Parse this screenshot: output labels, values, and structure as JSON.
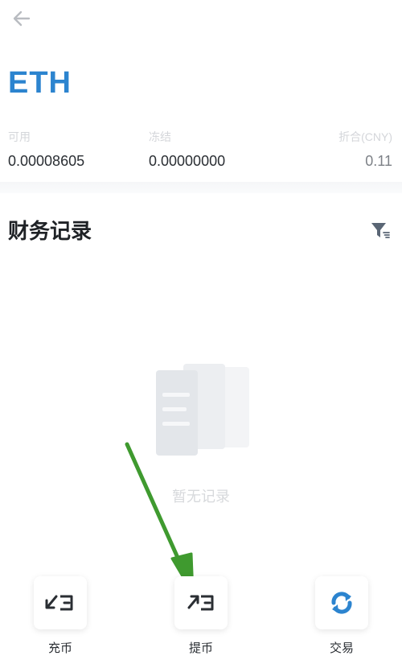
{
  "header": {
    "back_icon": "arrow-left-icon",
    "asset_title": "ETH"
  },
  "balances": {
    "available_label": "可用",
    "available_value": "0.00008605",
    "frozen_label": "冻结",
    "frozen_value": "0.00000000",
    "cny_label": "折合(CNY)",
    "cny_value": "0.11"
  },
  "records": {
    "title": "财务记录",
    "filter_icon": "filter-icon",
    "empty_text": "暂无记录"
  },
  "actions": {
    "deposit_label": "充币",
    "withdraw_label": "提币",
    "trade_label": "交易"
  },
  "colors": {
    "accent": "#2c84cf",
    "annotation_arrow": "#3f9a2f"
  }
}
